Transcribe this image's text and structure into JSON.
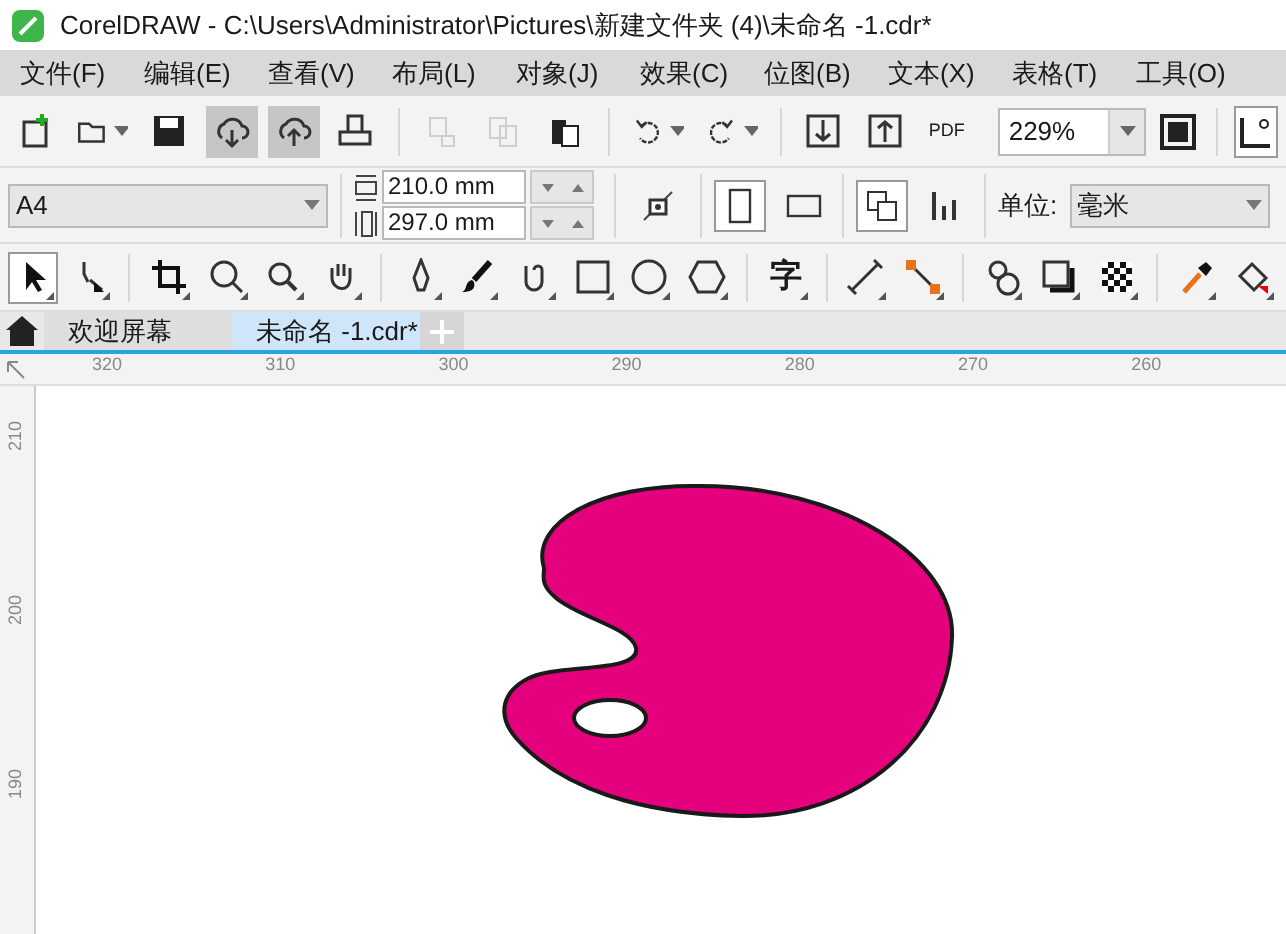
{
  "window": {
    "title": "CorelDRAW - C:\\Users\\Administrator\\Pictures\\新建文件夹 (4)\\未命名 -1.cdr*"
  },
  "menu": [
    "文件(F)",
    "编辑(E)",
    "查看(V)",
    "布局(L)",
    "对象(J)",
    "效果(C)",
    "位图(B)",
    "文本(X)",
    "表格(T)",
    "工具(O)"
  ],
  "toolbar": [
    {
      "kind": "new",
      "highlighted": false,
      "disabled": false
    },
    {
      "kind": "open",
      "highlighted": false,
      "disabled": false,
      "dropdown": true
    },
    {
      "kind": "save",
      "highlighted": false,
      "disabled": false
    },
    {
      "kind": "cloud-down",
      "highlighted": true,
      "disabled": false
    },
    {
      "kind": "cloud-up",
      "highlighted": true,
      "disabled": false
    },
    {
      "kind": "print",
      "highlighted": false,
      "disabled": false
    },
    {
      "kind": "sep"
    },
    {
      "kind": "cut",
      "highlighted": false,
      "disabled": true
    },
    {
      "kind": "copy",
      "highlighted": false,
      "disabled": true
    },
    {
      "kind": "paste",
      "highlighted": false,
      "disabled": false
    },
    {
      "kind": "sep"
    },
    {
      "kind": "undo",
      "highlighted": false,
      "disabled": false,
      "dropdown": true
    },
    {
      "kind": "redo",
      "highlighted": false,
      "disabled": false,
      "dropdown": true
    },
    {
      "kind": "sep"
    },
    {
      "kind": "import",
      "highlighted": false,
      "disabled": false
    },
    {
      "kind": "export",
      "highlighted": false,
      "disabled": false
    },
    {
      "kind": "pdf",
      "label": "PDF",
      "highlighted": false,
      "disabled": false
    }
  ],
  "zoom": {
    "value": "229%"
  },
  "property_bar": {
    "page_size": "A4",
    "width": "210.0 mm",
    "height": "297.0 mm",
    "portrait": true,
    "units_label": "单位:",
    "units": "毫米"
  },
  "toolbox": [
    {
      "kind": "pick",
      "selected": true
    },
    {
      "kind": "shape",
      "selected": false
    },
    {
      "kind": "sep"
    },
    {
      "kind": "crop",
      "selected": false
    },
    {
      "kind": "zoom",
      "selected": false
    },
    {
      "kind": "zoom2",
      "selected": false
    },
    {
      "kind": "pan",
      "selected": false
    },
    {
      "kind": "sep"
    },
    {
      "kind": "pen",
      "selected": false
    },
    {
      "kind": "brush",
      "selected": false
    },
    {
      "kind": "curve",
      "selected": false
    },
    {
      "kind": "rect",
      "selected": false
    },
    {
      "kind": "ellipse",
      "selected": false
    },
    {
      "kind": "polygon",
      "selected": false
    },
    {
      "kind": "sep"
    },
    {
      "kind": "text",
      "label": "字",
      "selected": false
    },
    {
      "kind": "sep"
    },
    {
      "kind": "dimension",
      "selected": false
    },
    {
      "kind": "connector",
      "selected": false
    },
    {
      "kind": "sep"
    },
    {
      "kind": "blend",
      "selected": false
    },
    {
      "kind": "shadow",
      "selected": false
    },
    {
      "kind": "transparency",
      "selected": false
    },
    {
      "kind": "sep"
    },
    {
      "kind": "eyedropper",
      "selected": false
    },
    {
      "kind": "fill",
      "selected": false
    }
  ],
  "tabs": [
    {
      "label": "欢迎屏幕",
      "selected": false
    },
    {
      "label": "未命名 -1.cdr*",
      "selected": true
    }
  ],
  "ruler": {
    "horizontal": [
      "320",
      "310",
      "300",
      "290",
      "280",
      "270",
      "260"
    ],
    "vertical": [
      "210",
      "200",
      "190"
    ]
  }
}
